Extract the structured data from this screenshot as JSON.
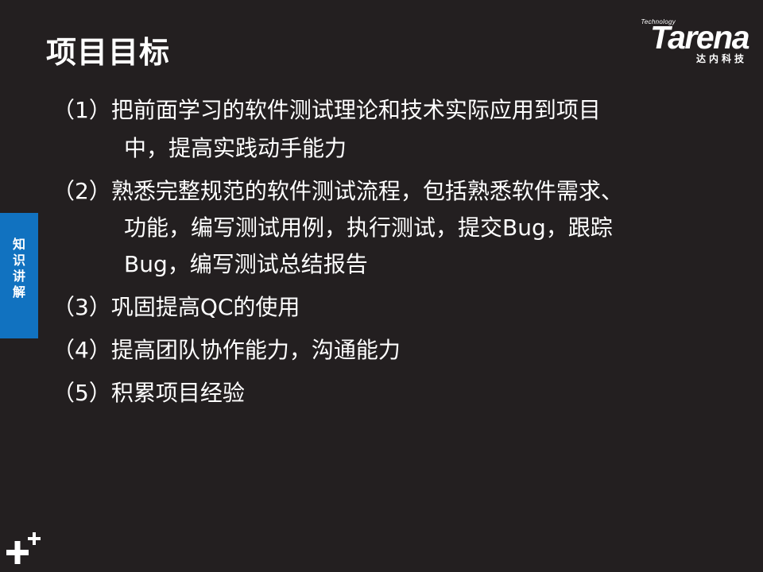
{
  "slide": {
    "title": "项目目标",
    "logo": {
      "tagline": "Technology",
      "wordmark": "Tarena",
      "subtitle": "达内科技"
    },
    "side_tab": {
      "chars": [
        "知",
        "识",
        "讲",
        "解"
      ]
    },
    "goals": [
      {
        "text": "（1）把前面学习的软件测试理论和技术实际应用到项目",
        "indent": false
      },
      {
        "text": "中，提高实践动手能力",
        "indent": true
      },
      {
        "text": "（2）熟悉完整规范的软件测试流程，包括熟悉软件需求、",
        "indent": false
      },
      {
        "text": "功能，编写测试用例，执行测试，提交Bug，跟踪",
        "indent": true
      },
      {
        "text": "Bug，编写测试总结报告",
        "indent": true
      },
      {
        "text": "（3）巩固提高QC的使用",
        "indent": false
      },
      {
        "text": "（4）提高团队协作能力，沟通能力",
        "indent": false
      },
      {
        "text": "（5）积累项目经验",
        "indent": false
      }
    ],
    "colors": {
      "background": "#231f20",
      "text": "#ffffff",
      "side_tab": "#1172c0"
    },
    "icons": [
      "plus-icon"
    ]
  }
}
